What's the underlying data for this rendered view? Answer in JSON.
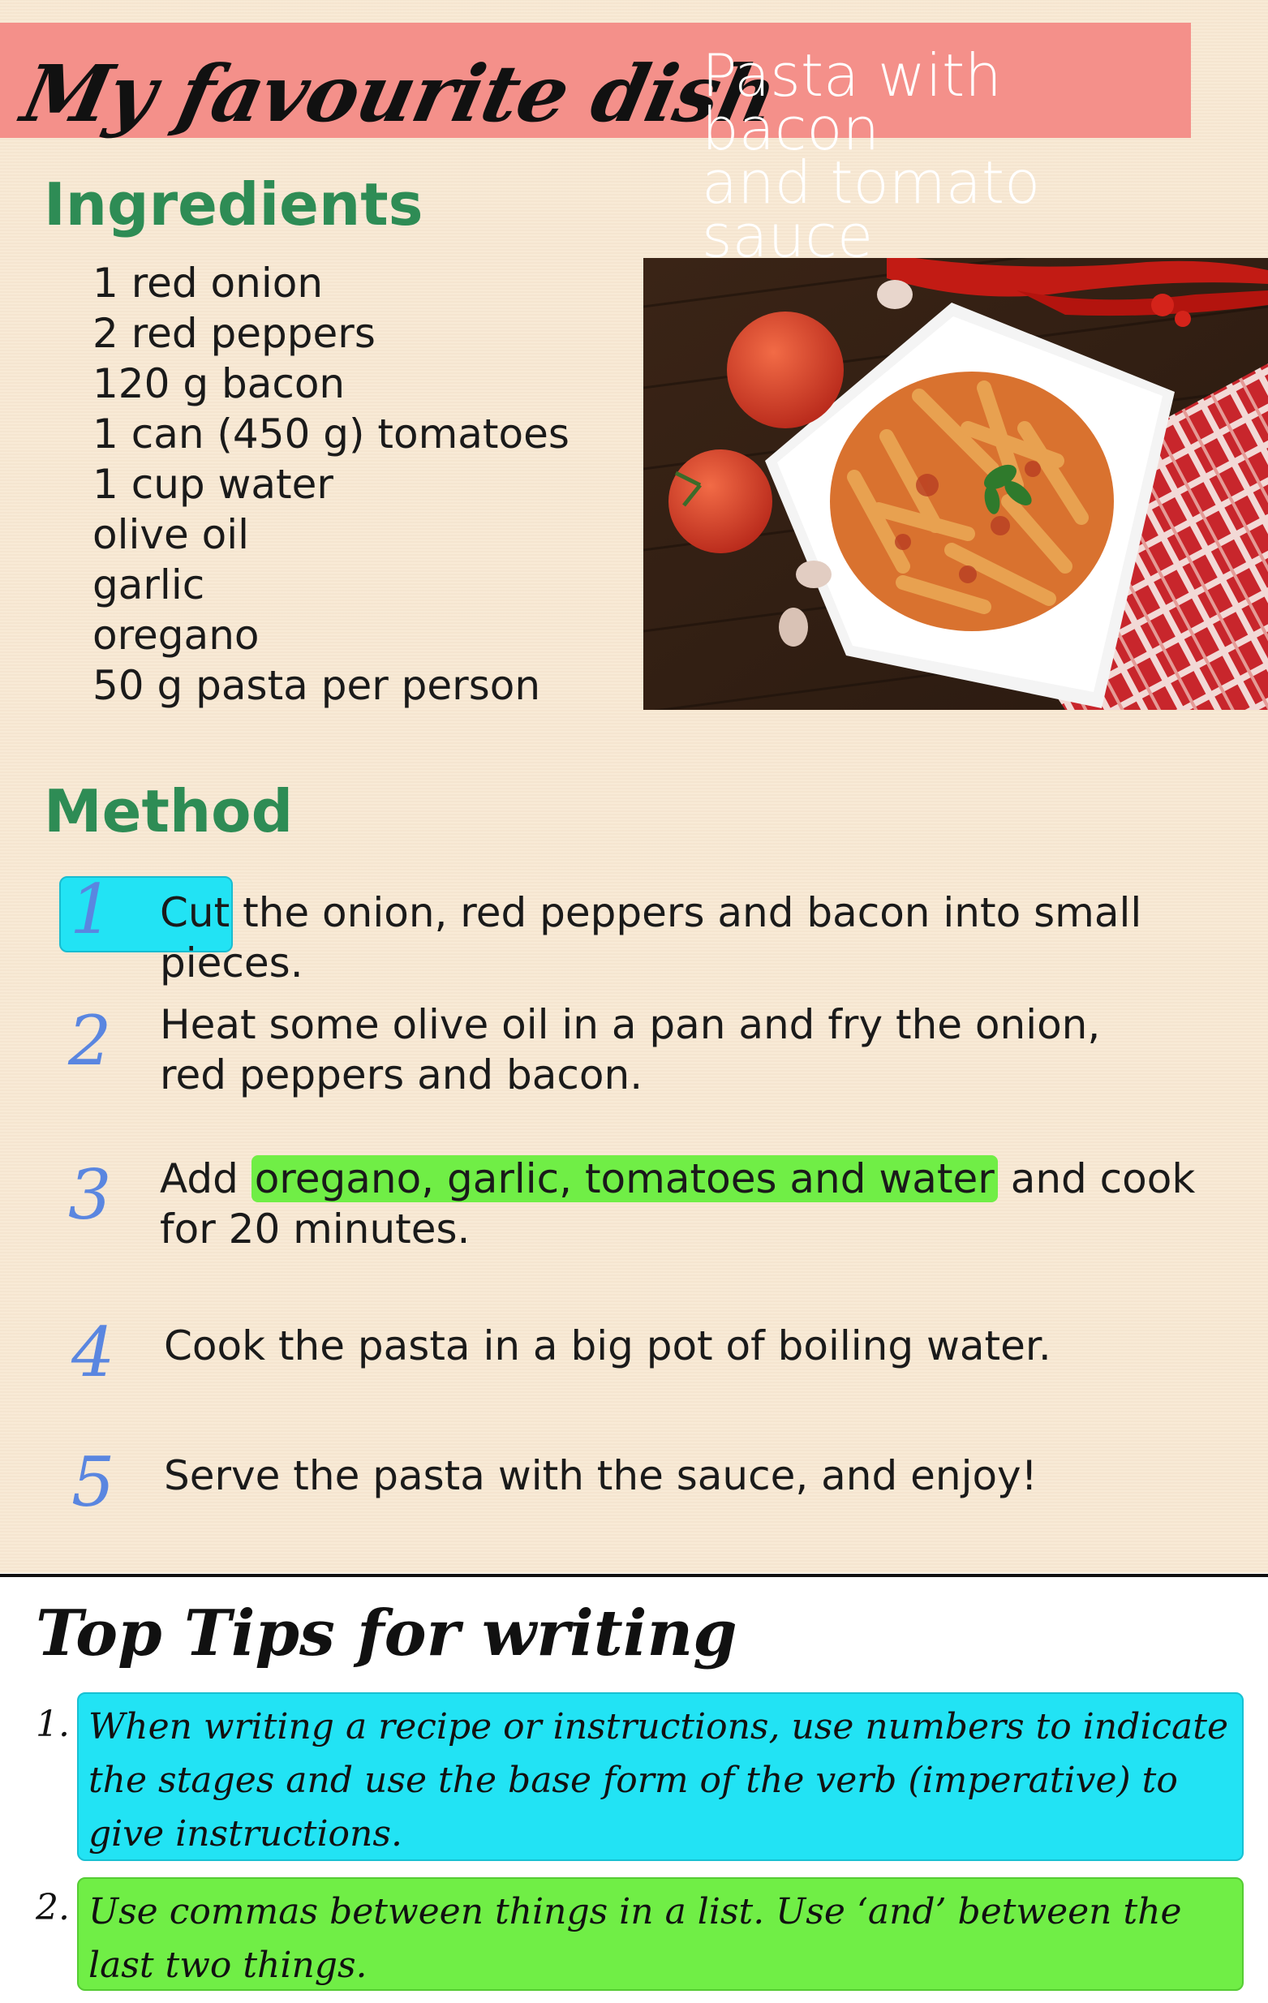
{
  "header": {
    "title": "My favourite dish",
    "dish_line1": "Pasta with bacon",
    "dish_line2": "and tomato sauce"
  },
  "ingredients": {
    "heading": "Ingredients",
    "items": [
      "1 red onion",
      "2 red peppers",
      "120 g bacon",
      "1 can (450 g) tomatoes",
      "1 cup water",
      "olive oil",
      "garlic",
      "oregano",
      "50 g pasta per person"
    ]
  },
  "method": {
    "heading": "Method",
    "steps": [
      {
        "number": "1",
        "highlight": "Cut",
        "text": " the onion, red peppers and bacon into small pieces."
      },
      {
        "number": "2",
        "text": "Heat some olive oil in a pan and fry the onion, red peppers and bacon."
      },
      {
        "number": "3",
        "before": "Add ",
        "highlight": "oregano, garlic, tomatoes and water",
        "after": " and cook for 20 minutes."
      },
      {
        "number": "4",
        "text": "Cook the pasta in a big pot of boiling water."
      },
      {
        "number": "5",
        "text": "Serve the pasta with the sauce, and enjoy!"
      }
    ]
  },
  "tips": {
    "title": "Top Tips for writing",
    "items": [
      {
        "number": "1.",
        "text": "When writing a recipe or instructions, use numbers to indicate the stages and use the base form of the verb (imperative) to give instructions."
      },
      {
        "number": "2.",
        "text": "Use commas between things in a list. Use ‘and’ between the last two things."
      }
    ]
  },
  "colors": {
    "banner": "#f4908a",
    "heading_green": "#2e8c55",
    "highlight_cyan": "#22e3f4",
    "highlight_green": "#70ee46",
    "step_number_blue": "#5a86e0",
    "background": "#f8e8d2"
  }
}
